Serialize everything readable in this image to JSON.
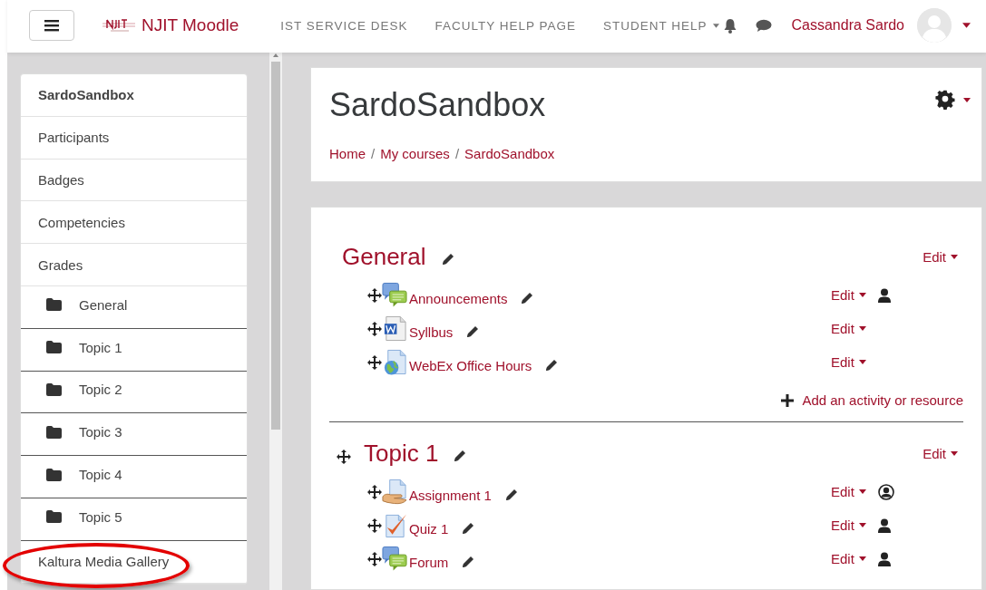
{
  "navbar": {
    "brand": "NJIT Moodle",
    "links": [
      {
        "label": "IST SERVICE DESK",
        "dropdown": false
      },
      {
        "label": "FACULTY HELP PAGE",
        "dropdown": false
      },
      {
        "label": "STUDENT HELP",
        "dropdown": true
      }
    ],
    "user": "Cassandra Sardo"
  },
  "sidebar": {
    "items": [
      {
        "label": "SardoSandbox",
        "kind": "course",
        "highlighted": false
      },
      {
        "label": "Participants",
        "kind": "link",
        "highlighted": false
      },
      {
        "label": "Badges",
        "kind": "link",
        "highlighted": false
      },
      {
        "label": "Competencies",
        "kind": "link",
        "highlighted": false
      },
      {
        "label": "Grades",
        "kind": "link",
        "highlighted": false
      },
      {
        "label": "General",
        "kind": "section",
        "highlighted": false
      },
      {
        "label": "Topic 1",
        "kind": "section",
        "highlighted": false
      },
      {
        "label": "Topic 2",
        "kind": "section",
        "highlighted": false
      },
      {
        "label": "Topic 3",
        "kind": "section",
        "highlighted": false
      },
      {
        "label": "Topic 4",
        "kind": "section",
        "highlighted": false
      },
      {
        "label": "Topic 5",
        "kind": "section",
        "highlighted": false
      },
      {
        "label": "Kaltura Media Gallery",
        "kind": "link",
        "highlighted": true
      }
    ]
  },
  "header": {
    "title": "SardoSandbox",
    "breadcrumb": [
      {
        "kind": "link",
        "text": "Home"
      },
      {
        "kind": "separator",
        "text": "/"
      },
      {
        "kind": "link",
        "text": "My courses"
      },
      {
        "kind": "separator",
        "text": "/"
      },
      {
        "kind": "link",
        "text": "SardoSandbox"
      }
    ]
  },
  "sections": [
    {
      "title": "General",
      "movable": false,
      "edit": "Edit",
      "add": "Add an activity or resource",
      "activities": [
        {
          "name": "Announcements",
          "kind": "forum",
          "edit": "Edit",
          "separate_groups": true,
          "visible_groups": false
        },
        {
          "name": "Syllbus",
          "kind": "document",
          "edit": "Edit",
          "separate_groups": false,
          "visible_groups": false
        },
        {
          "name": "WebEx Office Hours",
          "kind": "url",
          "edit": "Edit",
          "separate_groups": false,
          "visible_groups": false
        }
      ]
    },
    {
      "title": "Topic 1",
      "movable": true,
      "edit": "Edit",
      "activities": [
        {
          "name": "Assignment 1",
          "kind": "assignment",
          "edit": "Edit",
          "separate_groups": false,
          "visible_groups": true
        },
        {
          "name": "Quiz 1",
          "kind": "quiz",
          "edit": "Edit",
          "separate_groups": true,
          "visible_groups": false
        },
        {
          "name": "Forum",
          "kind": "forum",
          "edit": "Edit",
          "separate_groups": true,
          "visible_groups": false
        }
      ]
    }
  ]
}
